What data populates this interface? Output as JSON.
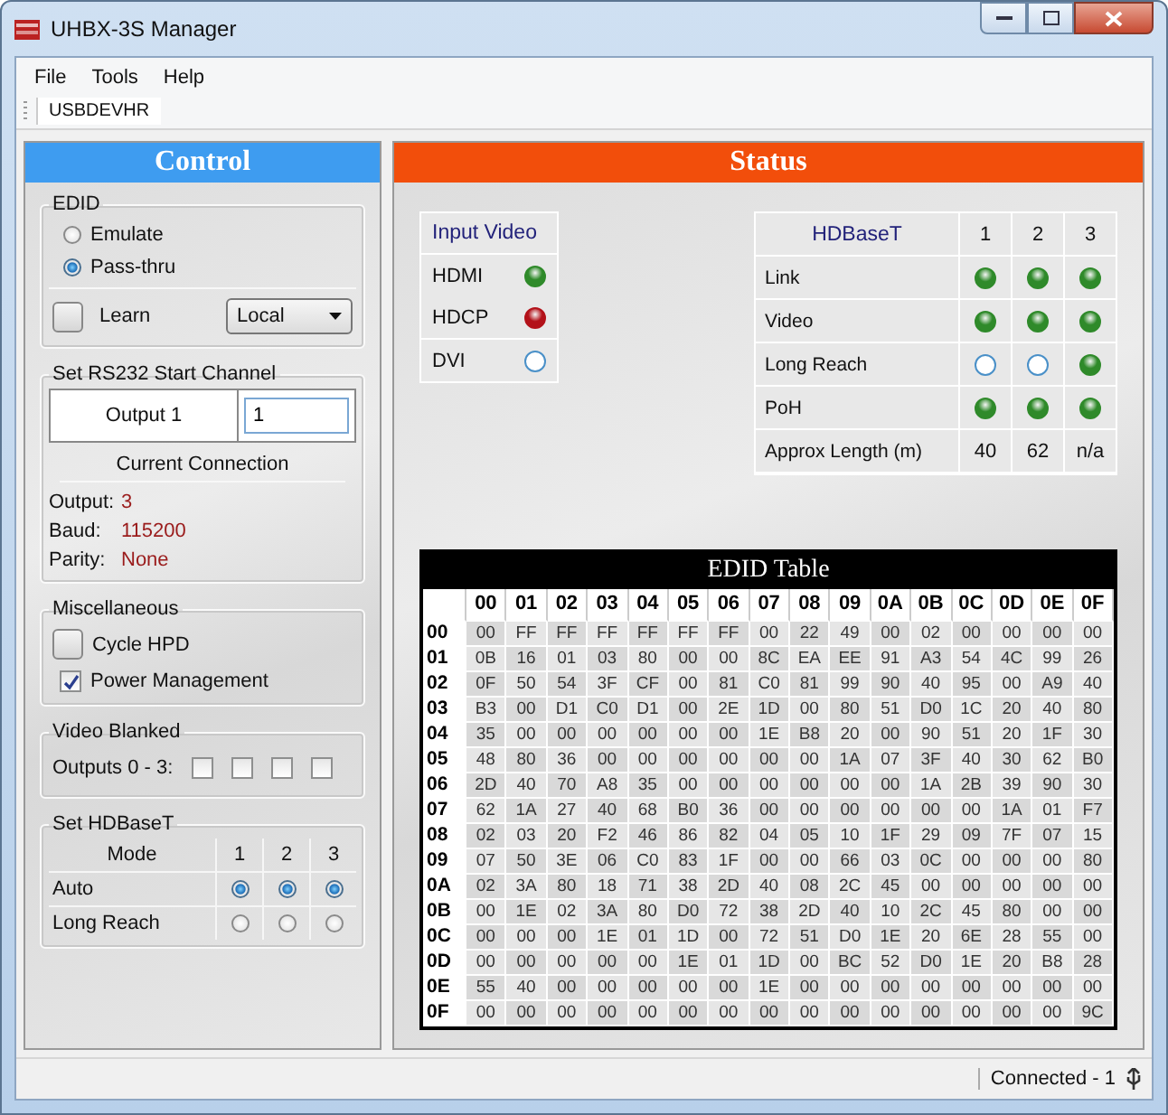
{
  "window": {
    "title": "UHBX-3S Manager"
  },
  "menu": [
    "File",
    "Tools",
    "Help"
  ],
  "toolbar": {
    "tab": "USBDEVHR"
  },
  "control": {
    "header": "Control",
    "edid": {
      "title": "EDID",
      "options": [
        {
          "label": "Emulate",
          "selected": false
        },
        {
          "label": "Pass-thru",
          "selected": true
        }
      ],
      "learn": {
        "label": "Learn",
        "checked": false
      },
      "source": "Local"
    },
    "rs232": {
      "title": "Set RS232 Start Channel",
      "output_label": "Output 1",
      "value": "1",
      "connection_title": "Current Connection",
      "fields": [
        {
          "label": "Output:",
          "value": "3"
        },
        {
          "label": "Baud:",
          "value": "115200"
        },
        {
          "label": "Parity:",
          "value": "None"
        }
      ]
    },
    "misc": {
      "title": "Miscellaneous",
      "items": [
        {
          "kind": "toggle",
          "label": "Cycle HPD",
          "checked": false
        },
        {
          "kind": "checkbox",
          "label": "Power Management",
          "checked": true
        }
      ]
    },
    "blanked": {
      "title": "Video Blanked",
      "label": "Outputs 0 - 3:",
      "outputs": [
        {
          "checked": false
        },
        {
          "checked": false
        },
        {
          "checked": false
        },
        {
          "checked": false
        }
      ]
    },
    "hdbaset_mode": {
      "title": "Set HDBaseT",
      "header": "Mode",
      "columns": [
        "1",
        "2",
        "3"
      ],
      "rows": [
        {
          "label": "Auto",
          "options": [
            {
              "selected": true
            },
            {
              "selected": true
            },
            {
              "selected": true
            }
          ]
        },
        {
          "label": "Long Reach",
          "options": [
            {
              "selected": false
            },
            {
              "selected": false
            },
            {
              "selected": false
            }
          ]
        }
      ]
    }
  },
  "status": {
    "header": "Status",
    "input_video": {
      "title": "Input Video",
      "rows": [
        {
          "label": "HDMI",
          "lit": true,
          "color": "#2f8a2a"
        },
        {
          "label": "HDCP",
          "lit": true,
          "color": "#b3121a"
        },
        {
          "label": "DVI",
          "lit": false,
          "color": "#4a90c8"
        }
      ]
    },
    "hdbaset": {
      "title": "HDBaseT",
      "columns": [
        "1",
        "2",
        "3"
      ],
      "rows": [
        {
          "kind": "leds",
          "label": "Link",
          "leds": [
            {
              "lit": true
            },
            {
              "lit": true
            },
            {
              "lit": true
            }
          ]
        },
        {
          "kind": "leds",
          "label": "Video",
          "leds": [
            {
              "lit": true
            },
            {
              "lit": true
            },
            {
              "lit": true
            }
          ]
        },
        {
          "kind": "leds",
          "label": "Long Reach",
          "leds": [
            {
              "lit": false
            },
            {
              "lit": false
            },
            {
              "lit": true
            }
          ]
        },
        {
          "kind": "leds",
          "label": "PoH",
          "leds": [
            {
              "lit": true
            },
            {
              "lit": true
            },
            {
              "lit": true
            }
          ]
        },
        {
          "kind": "text",
          "label": "Approx Length (m)",
          "values": [
            "40",
            "62",
            "n/a"
          ]
        }
      ]
    },
    "edid_table": {
      "title": "EDID Table",
      "columns": [
        "00",
        "01",
        "02",
        "03",
        "04",
        "05",
        "06",
        "07",
        "08",
        "09",
        "0A",
        "0B",
        "0C",
        "0D",
        "0E",
        "0F"
      ],
      "rows": [
        {
          "label": "00",
          "cells": [
            "00",
            "FF",
            "FF",
            "FF",
            "FF",
            "FF",
            "FF",
            "00",
            "22",
            "49",
            "00",
            "02",
            "00",
            "00",
            "00",
            "00"
          ]
        },
        {
          "label": "01",
          "cells": [
            "0B",
            "16",
            "01",
            "03",
            "80",
            "00",
            "00",
            "8C",
            "EA",
            "EE",
            "91",
            "A3",
            "54",
            "4C",
            "99",
            "26"
          ]
        },
        {
          "label": "02",
          "cells": [
            "0F",
            "50",
            "54",
            "3F",
            "CF",
            "00",
            "81",
            "C0",
            "81",
            "99",
            "90",
            "40",
            "95",
            "00",
            "A9",
            "40"
          ]
        },
        {
          "label": "03",
          "cells": [
            "B3",
            "00",
            "D1",
            "C0",
            "D1",
            "00",
            "2E",
            "1D",
            "00",
            "80",
            "51",
            "D0",
            "1C",
            "20",
            "40",
            "80"
          ]
        },
        {
          "label": "04",
          "cells": [
            "35",
            "00",
            "00",
            "00",
            "00",
            "00",
            "00",
            "1E",
            "B8",
            "20",
            "00",
            "90",
            "51",
            "20",
            "1F",
            "30"
          ]
        },
        {
          "label": "05",
          "cells": [
            "48",
            "80",
            "36",
            "00",
            "00",
            "00",
            "00",
            "00",
            "00",
            "1A",
            "07",
            "3F",
            "40",
            "30",
            "62",
            "B0"
          ]
        },
        {
          "label": "06",
          "cells": [
            "2D",
            "40",
            "70",
            "A8",
            "35",
            "00",
            "00",
            "00",
            "00",
            "00",
            "00",
            "1A",
            "2B",
            "39",
            "90",
            "30"
          ]
        },
        {
          "label": "07",
          "cells": [
            "62",
            "1A",
            "27",
            "40",
            "68",
            "B0",
            "36",
            "00",
            "00",
            "00",
            "00",
            "00",
            "00",
            "1A",
            "01",
            "F7"
          ]
        },
        {
          "label": "08",
          "cells": [
            "02",
            "03",
            "20",
            "F2",
            "46",
            "86",
            "82",
            "04",
            "05",
            "10",
            "1F",
            "29",
            "09",
            "7F",
            "07",
            "15"
          ]
        },
        {
          "label": "09",
          "cells": [
            "07",
            "50",
            "3E",
            "06",
            "C0",
            "83",
            "1F",
            "00",
            "00",
            "66",
            "03",
            "0C",
            "00",
            "00",
            "00",
            "80"
          ]
        },
        {
          "label": "0A",
          "cells": [
            "02",
            "3A",
            "80",
            "18",
            "71",
            "38",
            "2D",
            "40",
            "08",
            "2C",
            "45",
            "00",
            "00",
            "00",
            "00",
            "00"
          ]
        },
        {
          "label": "0B",
          "cells": [
            "00",
            "1E",
            "02",
            "3A",
            "80",
            "D0",
            "72",
            "38",
            "2D",
            "40",
            "10",
            "2C",
            "45",
            "80",
            "00",
            "00"
          ]
        },
        {
          "label": "0C",
          "cells": [
            "00",
            "00",
            "00",
            "1E",
            "01",
            "1D",
            "00",
            "72",
            "51",
            "D0",
            "1E",
            "20",
            "6E",
            "28",
            "55",
            "00"
          ]
        },
        {
          "label": "0D",
          "cells": [
            "00",
            "00",
            "00",
            "00",
            "00",
            "1E",
            "01",
            "1D",
            "00",
            "BC",
            "52",
            "D0",
            "1E",
            "20",
            "B8",
            "28"
          ]
        },
        {
          "label": "0E",
          "cells": [
            "55",
            "40",
            "00",
            "00",
            "00",
            "00",
            "00",
            "1E",
            "00",
            "00",
            "00",
            "00",
            "00",
            "00",
            "00",
            "00"
          ]
        },
        {
          "label": "0F",
          "cells": [
            "00",
            "00",
            "00",
            "00",
            "00",
            "00",
            "00",
            "00",
            "00",
            "00",
            "00",
            "00",
            "00",
            "00",
            "00",
            "9C"
          ]
        }
      ]
    }
  },
  "status_bar": {
    "text": "Connected - 1"
  }
}
